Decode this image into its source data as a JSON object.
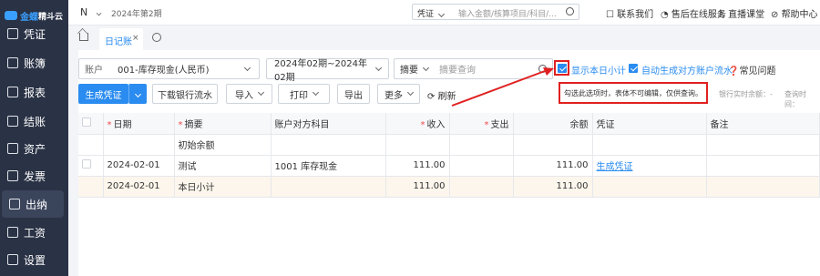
{
  "sidebar": {
    "logo_text": "金蝶",
    "brand_text": "精斗云",
    "items": [
      {
        "label": "凭证",
        "icon": "voucher-icon"
      },
      {
        "label": "账簿",
        "icon": "ledger-icon"
      },
      {
        "label": "报表",
        "icon": "report-icon"
      },
      {
        "label": "结账",
        "icon": "closing-icon"
      },
      {
        "label": "资产",
        "icon": "asset-icon"
      },
      {
        "label": "发票",
        "icon": "invoice-icon"
      },
      {
        "label": "出纳",
        "icon": "cashier-icon"
      },
      {
        "label": "工资",
        "icon": "salary-icon"
      },
      {
        "label": "设置",
        "icon": "settings-icon"
      }
    ],
    "active_index": 6
  },
  "topbar": {
    "account_initial": "N",
    "period": "2024年第2期",
    "search_select": "凭证",
    "search_placeholder": "输入金额/核算项目/科目/...",
    "links": [
      "联系我们",
      "售后在线服务",
      "直播课堂",
      "帮助中心"
    ]
  },
  "tabs": {
    "active_label": "日记账",
    "close": "×"
  },
  "filters": {
    "account_label": "账户",
    "account_value": "001-库存现金(人民币)",
    "period_range": "2024年02期~2024年02期",
    "summary_select": "摘要",
    "summary_placeholder": "摘要查询",
    "show_daily_subtotal_label": "显示本日小计",
    "auto_generate_label": "自动生成对方账户流水",
    "faq_label": "常见问题"
  },
  "toolbar": {
    "generate_voucher": "生成凭证",
    "download_bank_flow": "下载银行流水",
    "import": "导入",
    "print": "打印",
    "export": "导出",
    "more": "更多",
    "refresh": "刷新",
    "bank_balance_label": "银行实时余额：",
    "bank_balance_value": "-",
    "query_time_label": "查询时间："
  },
  "annotation": {
    "text": "勾选此选项时，表体不可编辑，仅供查询。"
  },
  "table": {
    "headers": [
      "日期",
      "摘要",
      "账户对方科目",
      "收入",
      "支出",
      "余额",
      "凭证",
      "备注"
    ],
    "rows": [
      {
        "date": "",
        "summary": "初始余额",
        "account": "",
        "income": "",
        "expense": "",
        "balance": "",
        "voucher": "",
        "note": ""
      },
      {
        "date": "2024-02-01",
        "summary": "测试",
        "account": "1001 库存现金",
        "income": "111.00",
        "expense": "",
        "balance": "111.00",
        "voucher": "生成凭证",
        "note": ""
      },
      {
        "date": "2024-02-01",
        "summary": "本日小计",
        "account": "",
        "income": "111.00",
        "expense": "",
        "balance": "111.00",
        "voucher": "",
        "note": ""
      }
    ]
  },
  "colors": {
    "accent": "#2a8cf0",
    "sidebar_bg": "#2a3245",
    "annotation_red": "#e02020",
    "subtotal_row_bg": "#fdf6ec"
  }
}
